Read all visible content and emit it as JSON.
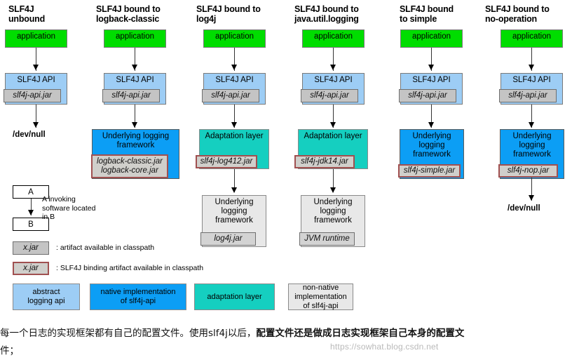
{
  "columns": [
    {
      "id": "unbound",
      "title": "SLF4J\nunbound",
      "nodes": {
        "application": "application",
        "api": "SLF4J API",
        "api_jar": "slf4j-api.jar",
        "terminal": "/dev/null"
      }
    },
    {
      "id": "logback-classic",
      "title": "SLF4J bound to\nlogback-classic",
      "nodes": {
        "application": "application",
        "api": "SLF4J API",
        "api_jar": "slf4j-api.jar",
        "framework": "Underlying logging\nframework",
        "framework_jar": "logback-classic.jar\nlogback-core.jar"
      }
    },
    {
      "id": "log4j",
      "title": "SLF4J bound to\nlog4j",
      "nodes": {
        "application": "application",
        "api": "SLF4J API",
        "api_jar": "slf4j-api.jar",
        "adaptation": "Adaptation layer",
        "adaptation_jar": "slf4j-log412.jar",
        "framework": "Underlying\nlogging\nframework",
        "framework_jar": "log4j.jar"
      }
    },
    {
      "id": "java-util-logging",
      "title": "SLF4J bound to\njava.util.logging",
      "nodes": {
        "application": "application",
        "api": "SLF4J API",
        "api_jar": "slf4j-api.jar",
        "adaptation": "Adaptation layer",
        "adaptation_jar": "slf4j-jdk14.jar",
        "framework": "Underlying\nlogging\nframework",
        "framework_jar": "JVM runtime"
      }
    },
    {
      "id": "simple",
      "title": "SLF4J bound\nto simple",
      "nodes": {
        "application": "application",
        "api": "SLF4J API",
        "api_jar": "slf4j-api.jar",
        "framework": "Underlying\nlogging\nframework",
        "framework_jar": "slf4j-simple.jar"
      }
    },
    {
      "id": "no-operation",
      "title": "SLF4J bound to\nno-operation",
      "nodes": {
        "application": "application",
        "api": "SLF4J API",
        "api_jar": "slf4j-api.jar",
        "framework": "Underlying\nlogging\nframework",
        "framework_jar": "slf4j-nop.jar",
        "terminal": "/dev/null"
      }
    }
  ],
  "legend": {
    "invocation": {
      "box_a": "A",
      "box_b": "B",
      "description": "A invoking\nsoftware located\nin B"
    },
    "artifact": {
      "chip": "x.jar",
      "description": ": artifact available in classpath"
    },
    "binding_artifact": {
      "chip": "x.jar",
      "description": ": SLF4J binding artifact available in classpath"
    },
    "swatches": [
      {
        "label": "abstract\nlogging api",
        "color": "#9dcdf5"
      },
      {
        "label": "native implementation\nof slf4j-api",
        "color": "#0c9ef5"
      },
      {
        "label": "adaptation layer",
        "color": "#15cfc0"
      },
      {
        "label": "non-native\nimplementation\nof slf4j-api",
        "color": "#e8e8e8"
      }
    ]
  },
  "caption": {
    "part1": "每一个日志的实现框架都有自己的配置文件。使用slf4j以后，",
    "part2": "配置文件还是做成日志实现框架自己本身的配置文",
    "part3": "件；",
    "watermark": "https://sowhat.blog.csdn.net"
  }
}
